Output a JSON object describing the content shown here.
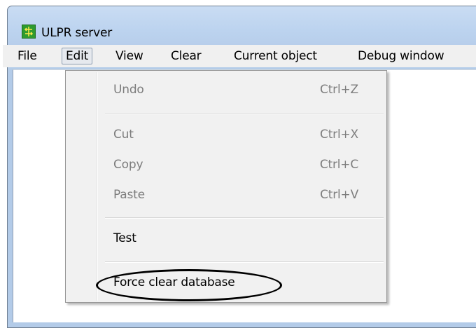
{
  "window": {
    "title": "ULPR server"
  },
  "menubar": {
    "items": [
      "File",
      "Edit",
      "View",
      "Clear",
      "Current object",
      "Debug window"
    ]
  },
  "edit_menu": {
    "items": [
      {
        "label": "Undo",
        "shortcut": "Ctrl+Z",
        "enabled": false
      },
      {
        "label": "Cut",
        "shortcut": "Ctrl+X",
        "enabled": false
      },
      {
        "label": "Copy",
        "shortcut": "Ctrl+C",
        "enabled": false
      },
      {
        "label": "Paste",
        "shortcut": "Ctrl+V",
        "enabled": false
      },
      {
        "label": "Test",
        "shortcut": "",
        "enabled": true
      },
      {
        "label": "Force clear database",
        "shortcut": "",
        "enabled": true,
        "highlighted": true
      }
    ]
  },
  "icons": {
    "app": "green-arrows-app-icon"
  },
  "colors": {
    "titlebar": "#bcd3ef",
    "menubar": "#f0f0f0",
    "dropdown": "#f1f1f1",
    "disabled_text": "#7d7d7d",
    "app_icon": "#2e9b2e"
  }
}
